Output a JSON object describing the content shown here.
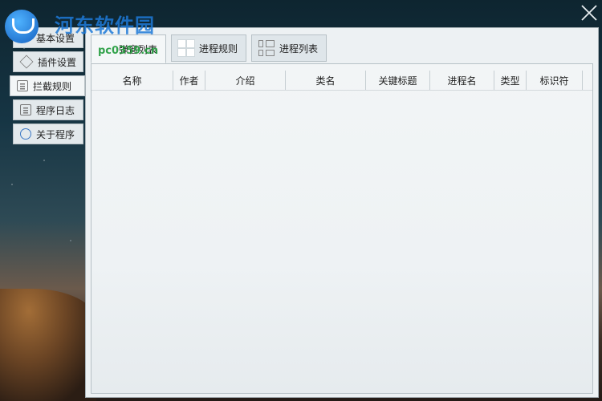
{
  "watermark": {
    "title": "河东软件园",
    "url": "pc0359.cn"
  },
  "sidebar": {
    "items": [
      {
        "label": "基本设置"
      },
      {
        "label": "插件设置"
      },
      {
        "label": "拦截规则"
      },
      {
        "label": "程序日志"
      },
      {
        "label": "关于程序"
      }
    ]
  },
  "tabs": [
    {
      "label": "弹窗列表"
    },
    {
      "label": "进程规则"
    },
    {
      "label": "进程列表"
    }
  ],
  "table": {
    "columns": [
      "名称",
      "作者",
      "介绍",
      "类名",
      "关键标题",
      "进程名",
      "类型",
      "标识符"
    ],
    "rows": []
  }
}
